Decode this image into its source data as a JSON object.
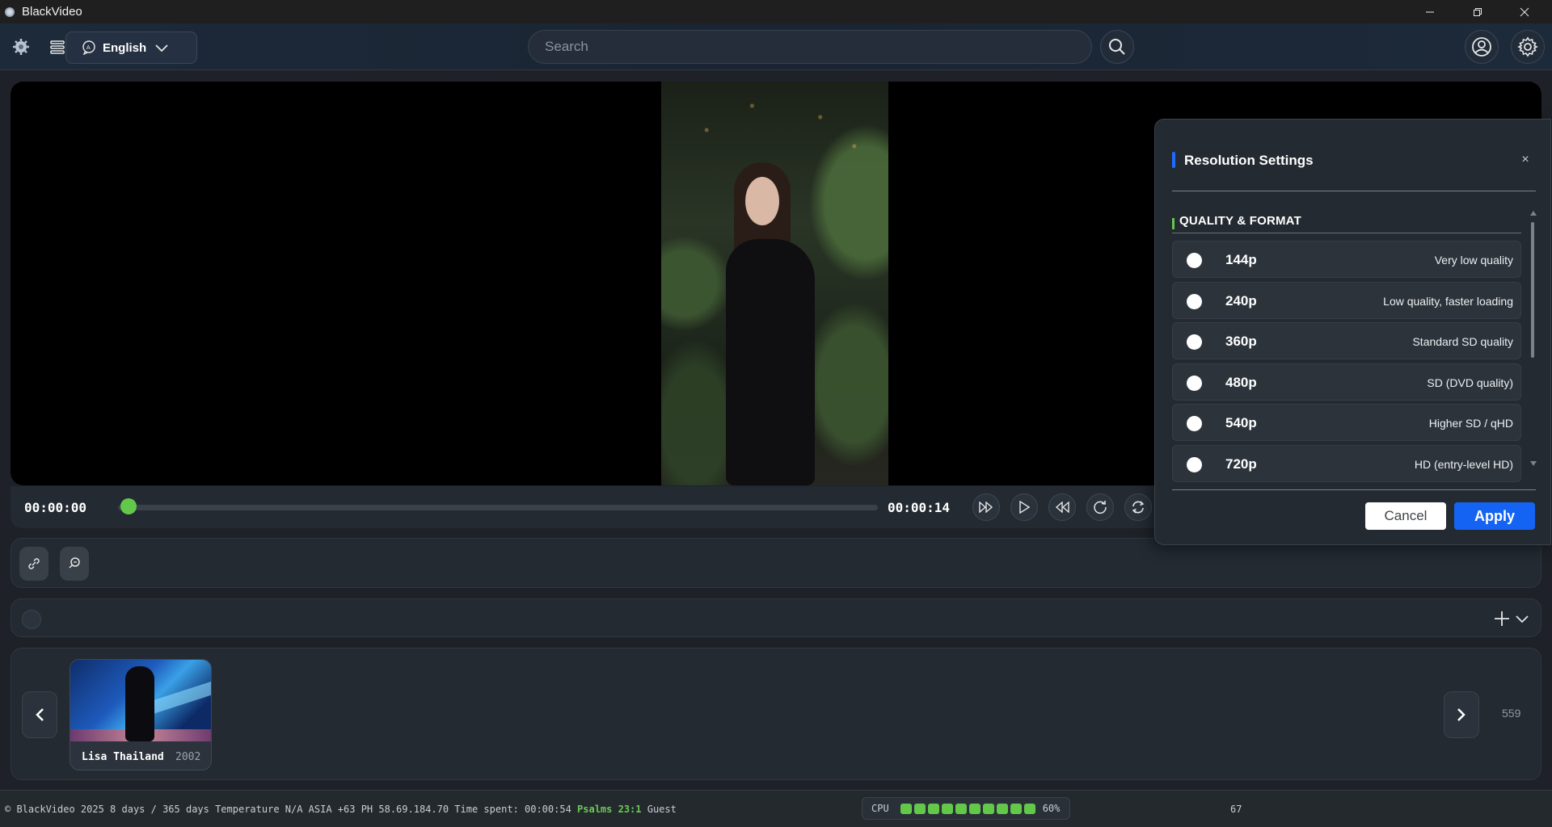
{
  "window": {
    "title": "BlackVideo"
  },
  "header": {
    "language": "English",
    "search_placeholder": "Search"
  },
  "player": {
    "current_time": "00:00:00",
    "duration": "00:00:14",
    "progress_fraction": 0.0
  },
  "resolution_dialog": {
    "title": "Resolution Settings",
    "close": "×",
    "section_title": "QUALITY & FORMAT",
    "options": [
      {
        "label": "144p",
        "description": "Very low quality"
      },
      {
        "label": "240p",
        "description": "Low quality, faster loading"
      },
      {
        "label": "360p",
        "description": "Standard SD quality"
      },
      {
        "label": "480p",
        "description": "SD (DVD quality)"
      },
      {
        "label": "540p",
        "description": "Higher SD / qHD"
      },
      {
        "label": "720p",
        "description": "HD (entry-level HD)"
      }
    ],
    "cancel_label": "Cancel",
    "apply_label": "Apply"
  },
  "gallery": {
    "items": [
      {
        "title": "Lisa Thailand",
        "year": "2002"
      }
    ],
    "count": "559"
  },
  "statusbar": {
    "text_main": "© BlackVideo 2025  8 days / 365 days  Temperature N/A  ASIA +63 PH  58.69.184.70  Time spent: 00:00:54 ",
    "psalms": "Psalms 23:1",
    "user": " Guest",
    "cpu_label": "CPU",
    "cpu_percent": "60%",
    "extra_number": "67"
  },
  "colors": {
    "accent_blue": "#1463f3",
    "accent_green": "#63c84a",
    "panel": "#242a31"
  }
}
